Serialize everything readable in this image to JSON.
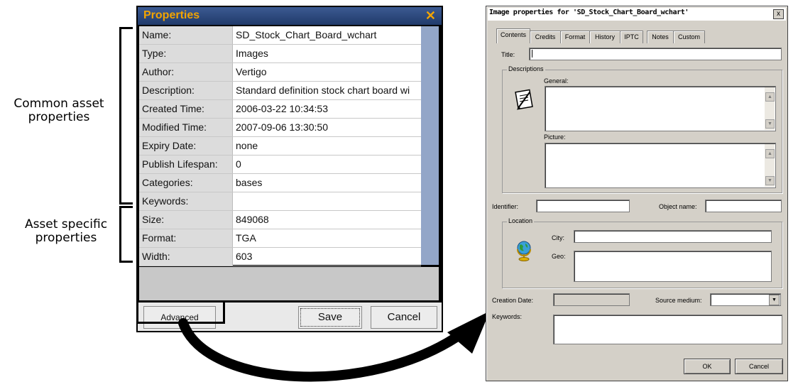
{
  "annotations": {
    "common_label": "Common asset properties",
    "common_line1": "Common asset",
    "common_line2": "properties",
    "specific_line1": "Asset specific",
    "specific_line2": "properties"
  },
  "properties_panel": {
    "title": "Properties",
    "rows": [
      {
        "key": "Name:",
        "value": "SD_Stock_Chart_Board_wchart"
      },
      {
        "key": "Type:",
        "value": "Images"
      },
      {
        "key": "Author:",
        "value": "Vertigo"
      },
      {
        "key": "Description:",
        "value": "Standard definition stock chart board wi"
      },
      {
        "key": "Created Time:",
        "value": "2006-03-22 10:34:53"
      },
      {
        "key": "Modified Time:",
        "value": "2007-09-06 13:30:50"
      },
      {
        "key": "Expiry Date:",
        "value": "none"
      },
      {
        "key": "Publish Lifespan:",
        "value": "0"
      },
      {
        "key": "Categories:",
        "value": "bases"
      },
      {
        "key": "Keywords:",
        "value": ""
      },
      {
        "key": "Size:",
        "value": "849068"
      },
      {
        "key": "Format:",
        "value": "TGA"
      },
      {
        "key": "Width:",
        "value": "603"
      }
    ],
    "advanced_label": "Advanced",
    "save_label": "Save",
    "cancel_label": "Cancel"
  },
  "dialog": {
    "title": "Image properties for 'SD_Stock_Chart_Board_wchart'",
    "close_glyph": "x",
    "tabs": [
      "Contents",
      "Credits",
      "Format",
      "History",
      "IPTC",
      "Notes",
      "Custom"
    ],
    "title_label": "Title:",
    "descriptions_label": "Descriptions",
    "general_label": "General:",
    "picture_label": "Picture:",
    "identifier_label": "Identifier:",
    "object_name_label": "Object name:",
    "location_label": "Location",
    "city_label": "City:",
    "geo_label": "Geo:",
    "creation_date_label": "Creation Date:",
    "source_medium_label": "Source medium:",
    "keywords_label": "Keywords:",
    "ok_label": "OK",
    "cancel_label": "Cancel",
    "scroll_up_glyph": "▲",
    "scroll_down_glyph": "▼",
    "dropdown_glyph": "▼"
  }
}
